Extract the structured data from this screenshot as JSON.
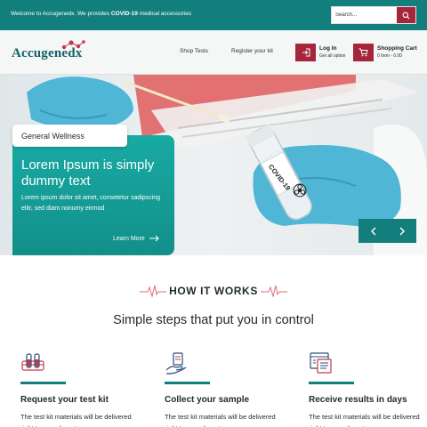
{
  "topbar": {
    "welcome_prefix": "Welcome to Accugenedx.   We provides ",
    "welcome_bold": "COVID-19",
    "welcome_suffix": " medical accessories",
    "search_placeholder": "Search..."
  },
  "header": {
    "logo_text": "Accugenedx",
    "nav": [
      "Shop Tests",
      "Register your kit"
    ],
    "login_title": "Log In",
    "login_sub": "Get all option",
    "cart_title": "Shopping Cart",
    "cart_sub": "0 Item - 0.00"
  },
  "hero": {
    "tag": "General Wellness",
    "heading": "Lorem Ipsum is simply dummy text",
    "body": "Lorem ipsum dolor sit amet, consetetur sadipscing elitr, sed diam nonumy eirmod",
    "cta": "Learn More",
    "tube_label": "COVID-19"
  },
  "how": {
    "title": "HOW IT WORKS",
    "subtitle": "Simple steps that put you in control",
    "steps": [
      {
        "title": "Request your test kit",
        "text": "The test kit materials will be delivered right to your doorstep"
      },
      {
        "title": "Collect your sample",
        "text": "The test kit materials will be delivered right to your doorstep"
      },
      {
        "title": "Receive results in days",
        "text": "The test kit materials will be delivered right to your doorstep"
      }
    ]
  },
  "colors": {
    "teal": "#127f7c",
    "teal_light": "#19aaa4",
    "crimson": "#a5263a"
  },
  "icons": [
    "search-icon",
    "login-icon",
    "cart-icon",
    "arrow-right-icon",
    "chevron-left-icon",
    "chevron-right-icon",
    "pulse-icon",
    "test-tubes-icon",
    "sample-hand-icon",
    "results-document-icon"
  ]
}
